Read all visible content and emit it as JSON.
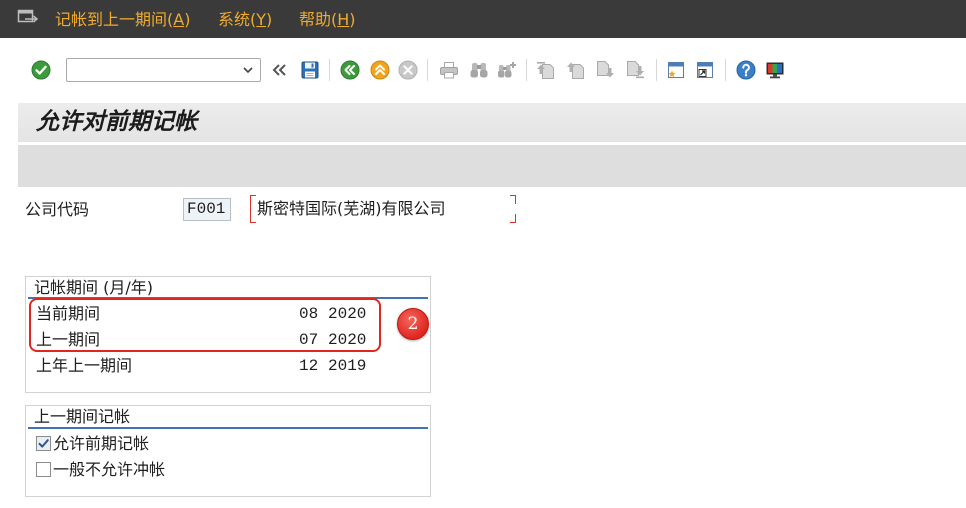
{
  "menu_bar": {
    "items": [
      {
        "text": "记帐到上一期间(",
        "mnemonic": "A",
        "tail": ")"
      },
      {
        "text": "系统(",
        "mnemonic": "Y",
        "tail": ")"
      },
      {
        "text": "帮助(",
        "mnemonic": "H",
        "tail": ")"
      }
    ],
    "icon": "sap-menu-icon"
  },
  "toolbar": {
    "command_field": {
      "value": ""
    },
    "icons": [
      "enter-icon",
      "collapse-command-field-icon",
      "save-icon",
      "back-icon",
      "exit-icon",
      "cancel-icon",
      "print-icon",
      "find-icon",
      "find-next-icon",
      "first-page-icon",
      "previous-page-icon",
      "next-page-icon",
      "last-page-icon",
      "create-session-icon",
      "shortcut-icon",
      "help-icon",
      "customize-layout-icon"
    ]
  },
  "title": "允许对前期记帐",
  "company": {
    "label": "公司代码",
    "code": "F001",
    "name": "斯密特国际(芜湖)有限公司"
  },
  "posting_periods": {
    "title": "记帐期间 (月/年)",
    "rows": [
      {
        "label": "当前期间",
        "month": "08",
        "year": "2020"
      },
      {
        "label": "上一期间",
        "month": "07",
        "year": "2020"
      },
      {
        "label": "上年上一期间",
        "month": "12",
        "year": "2019"
      }
    ]
  },
  "annotation": {
    "badge": "2"
  },
  "prior_period_posting": {
    "title": "上一期间记帐",
    "options": [
      {
        "label": "允许前期记帐",
        "checked": true
      },
      {
        "label": "一般不允许冲帐",
        "checked": false
      }
    ]
  },
  "colors": {
    "menu-bg": "#3a3a3a",
    "menu-fg": "#f0ab2c",
    "title-bg": "#e4e4e4",
    "strip-bg": "#dedede",
    "group-line": "#4272b8",
    "annotation": "#e0261f",
    "field-bg": "#eef3f7"
  }
}
